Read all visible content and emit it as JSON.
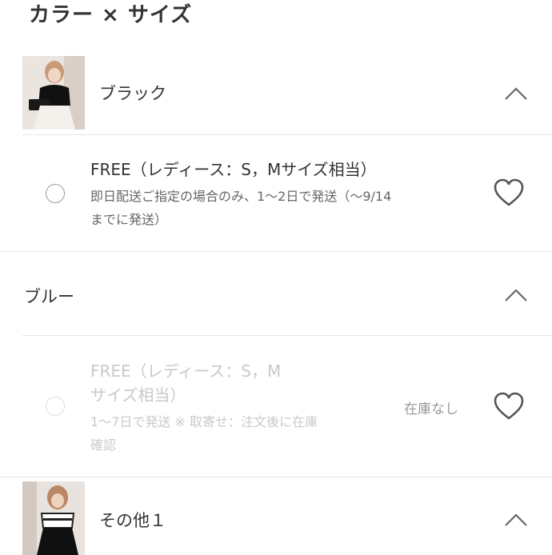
{
  "title": "カラー × サイズ",
  "colors": [
    {
      "name": "ブラック",
      "sizes": [
        {
          "name": "FREE（レディース：S，Mサイズ相当）",
          "note_line1": "即日配送ご指定の場合のみ、1〜2日で発送（〜9/14",
          "note_line2": "までに発送）",
          "stock": ""
        }
      ]
    },
    {
      "name": "ブルー",
      "sizes": [
        {
          "name_line1": "FREE（レディース：S，M",
          "name_line2": "サイズ相当）",
          "note_line1": "1〜7日で発送 ※ 取寄せ：注文後に在庫",
          "note_line2": "確認",
          "stock": "在庫なし"
        }
      ]
    },
    {
      "name": "その他１",
      "sizes": []
    }
  ],
  "icons": {
    "chevron": "chevron-up-icon",
    "favorite": "heart-outline-icon",
    "radio": "radio-unselected"
  },
  "colors_palette": {
    "text": "#333333",
    "subtext": "#666666",
    "disabled": "#c9c9c9",
    "divider": "#e6e6e6"
  }
}
